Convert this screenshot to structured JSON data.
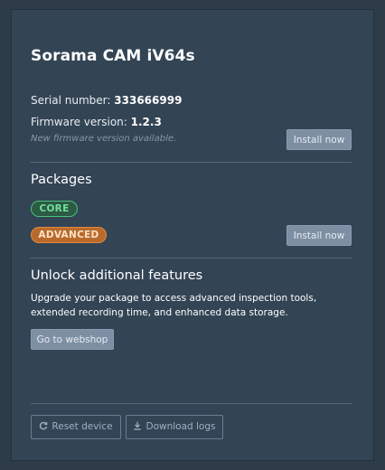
{
  "device": {
    "name": "Sorama CAM iV64s",
    "serial_label": "Serial number:",
    "serial_value": "333666999",
    "firmware_label": "Firmware version:",
    "firmware_value": "1.2.3",
    "firmware_note": "New firmware version available.",
    "install_firmware_label": "Install now"
  },
  "packages": {
    "title": "Packages",
    "items": [
      {
        "label": "CORE",
        "color": "#48c27a"
      },
      {
        "label": "ADVANCED",
        "color": "#e28a3c"
      }
    ],
    "install_label": "Install now"
  },
  "unlock": {
    "title": "Unlock additional features",
    "description": "Upgrade your package to access advanced inspection tools, extended recording time, and enhanced data storage.",
    "webshop_label": "Go to webshop"
  },
  "actions": {
    "reset_label": "Reset device",
    "reset_icon": "refresh-icon",
    "download_label": "Download logs",
    "download_icon": "download-icon"
  },
  "colors": {
    "panel_bg": "#334455",
    "core_green": "#48c27a",
    "advanced_orange": "#e28a3c",
    "button_fill": "#7d8fa3"
  }
}
